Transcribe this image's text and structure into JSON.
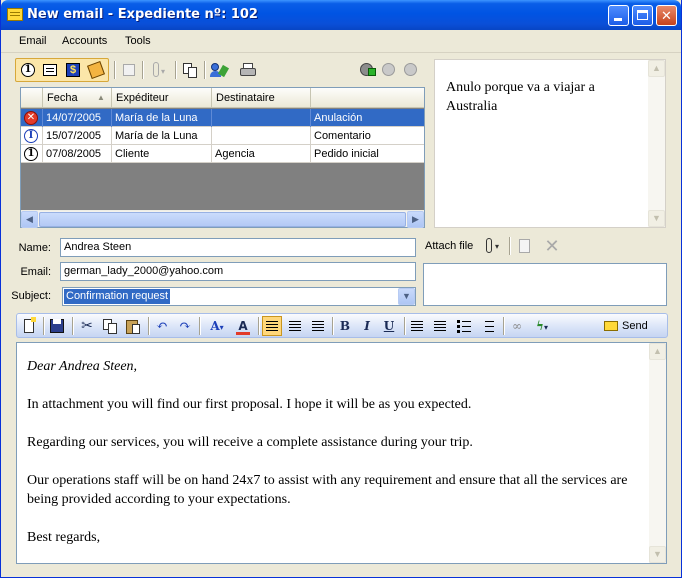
{
  "window": {
    "title": "New email - Expediente nº: 102",
    "controls": {
      "minimize_icon": "minimize-icon",
      "maximize_icon": "maximize-icon",
      "close_glyph": "✕"
    }
  },
  "menu": {
    "items": [
      "Email",
      "Accounts",
      "Tools"
    ]
  },
  "grid": {
    "columns": [
      "Fecha",
      "Expéditeur",
      "Destinataire",
      ""
    ],
    "rows": [
      {
        "icon_glyph": "✕",
        "status": "error",
        "date": "14/07/2005",
        "sender": "María de la Luna",
        "recipient": "",
        "subject": "Anulación",
        "selected": true
      },
      {
        "icon_glyph": "I",
        "status": "info",
        "date": "15/07/2005",
        "sender": "María de la Luna",
        "recipient": "",
        "subject": "Comentario",
        "selected": false
      },
      {
        "icon_glyph": "1",
        "status": "first",
        "date": "07/08/2005",
        "sender": "Cliente",
        "recipient": "Agencia",
        "subject": "Pedido inicial",
        "selected": false
      }
    ]
  },
  "note": {
    "text": "Anulo porque va a viajar a Australia"
  },
  "form": {
    "name_label": "Name:",
    "name_value": "Andrea Steen",
    "email_label": "Email:",
    "email_value": "german_lady_2000@yahoo.com",
    "subject_label": "Subject:",
    "subject_value": "Confirmation request",
    "attach_label": "Attach file"
  },
  "editor_toolbar": {
    "bold": "B",
    "italic": "I",
    "underline": "U",
    "font_color_glyph": "A",
    "send_label": "Send"
  },
  "editor": {
    "paragraphs": [
      "Dear Andrea Steen,",
      "In attachment you will find our first proposal. I hope it will be as you expected.",
      "Regarding our services, you will receive a complete assistance during your trip.",
      "Our operations staff will be on hand 24x7 to assist with any requirement and ensure that all the services are being provided according to your expectations.",
      "Best regards,"
    ]
  },
  "colors": {
    "title_bar": "#0054e3",
    "selection": "#316ac5",
    "grid_background": "#808080",
    "toolbar_highlight": "#ffd77a"
  }
}
